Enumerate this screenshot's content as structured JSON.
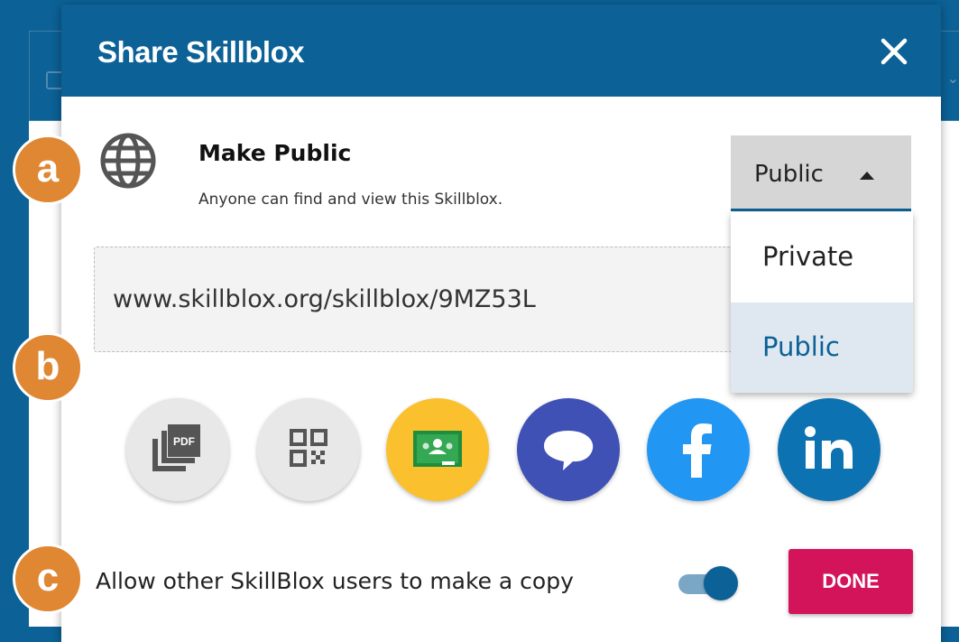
{
  "dialog": {
    "title": "Share Skillblox",
    "close_icon": "close-icon"
  },
  "visibility": {
    "icon": "globe-icon",
    "heading": "Make Public",
    "description": "Anyone can find and view this Skillblox.",
    "selected": "Public",
    "options": [
      "Private",
      "Public"
    ]
  },
  "share_url": "www.skillblox.org/skillblox/9MZ53L",
  "share_buttons": [
    {
      "icon": "pdf-icon",
      "color": "#e8e8e8"
    },
    {
      "icon": "qr-code-icon",
      "color": "#e8e8e8"
    },
    {
      "icon": "google-classroom-icon",
      "color": "#fbc02d"
    },
    {
      "icon": "chat-bubble-icon",
      "color": "#3f51b5"
    },
    {
      "icon": "facebook-icon",
      "color": "#2196f3"
    },
    {
      "icon": "linkedin-icon",
      "color": "#0d72b1"
    }
  ],
  "allow_copy": {
    "label": "Allow other SkillBlox users to make a copy",
    "enabled": true
  },
  "done_label": "DONE",
  "callouts": [
    "a",
    "b",
    "c"
  ],
  "colors": {
    "brand": "#0c6196",
    "done": "#d4145a",
    "callout": "#df8733"
  }
}
